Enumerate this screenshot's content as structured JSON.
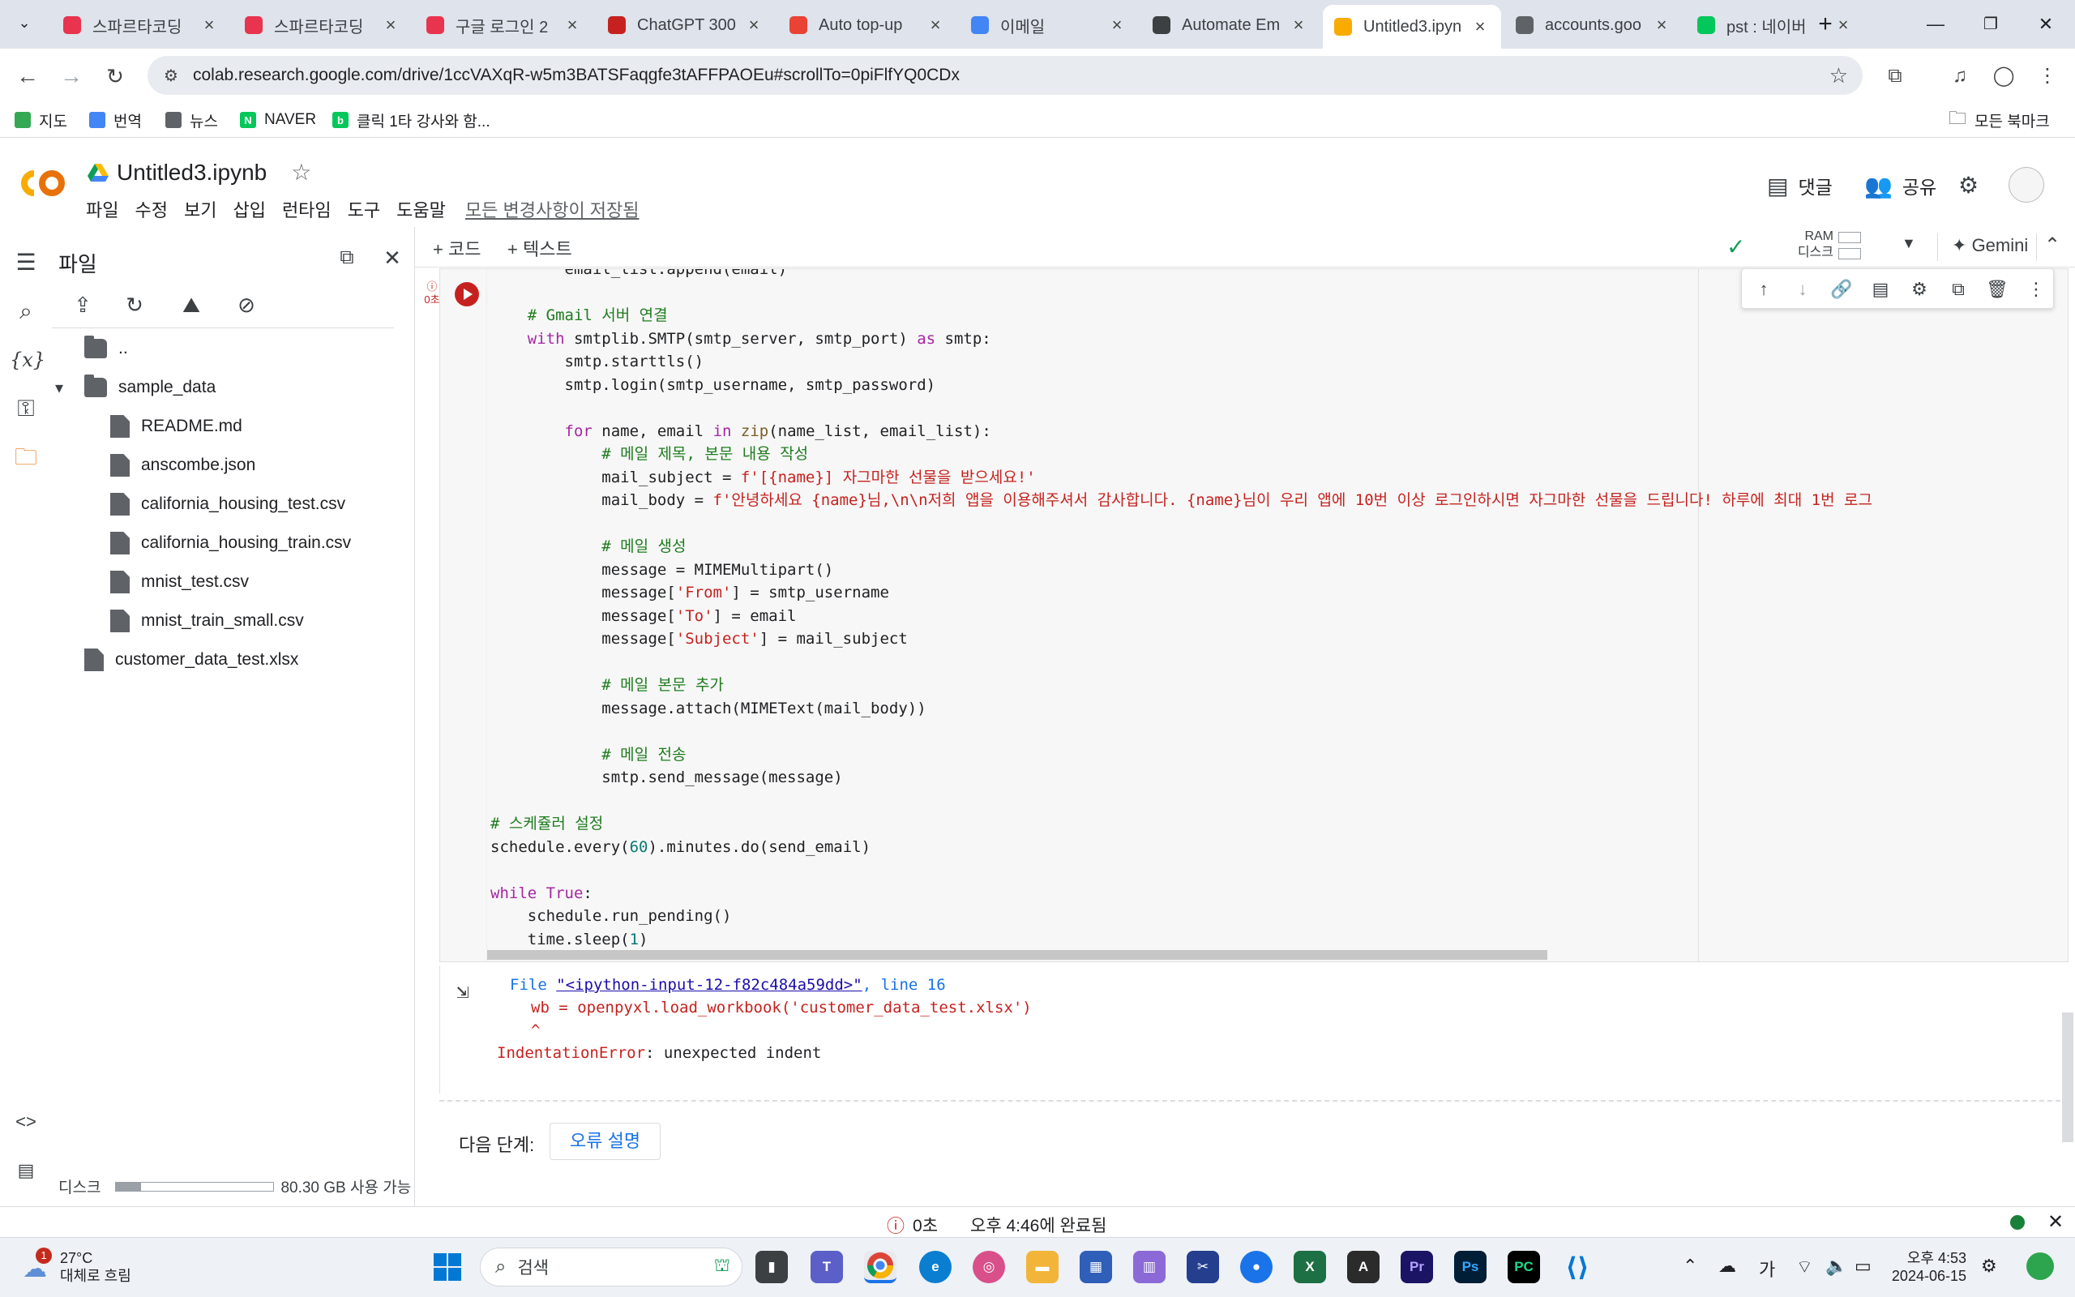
{
  "browser": {
    "tabs": [
      {
        "title": "스파르타코딩",
        "favicon_color": "#e8344e"
      },
      {
        "title": "스파르타코딩",
        "favicon_color": "#e8344e"
      },
      {
        "title": "구글 로그인 2",
        "favicon_color": "#e8344e"
      },
      {
        "title": "ChatGPT 300",
        "favicon_color": "#c5221f"
      },
      {
        "title": "Auto top-up",
        "favicon_color": "#ea4335"
      },
      {
        "title": "이메일",
        "favicon_color": "#4285f4"
      },
      {
        "title": "Automate Em",
        "favicon_color": "#3c4043"
      },
      {
        "title": "Untitled3.ipyn",
        "favicon_color": "#f9ab00"
      },
      {
        "title": "accounts.goo",
        "favicon_color": "#5f6368"
      },
      {
        "title": "pst : 네이버",
        "favicon_color": "#03c75a"
      }
    ],
    "active_tab_index": 7,
    "url": "colab.research.google.com/drive/1ccVAXqR-w5m3BATSFaqgfe3tAFFPAOEu#scrollTo=0piFlfYQ0CDx",
    "bookmarks": [
      {
        "label": "지도",
        "color": "#34a853"
      },
      {
        "label": "번역",
        "color": "#4285f4"
      },
      {
        "label": "뉴스",
        "color": "#5f6368"
      },
      {
        "label": "NAVER",
        "color": "#03c75a",
        "glyph": "N"
      },
      {
        "label": "클릭 1타 강사와 함...",
        "color": "#03c75a",
        "glyph": "b"
      }
    ],
    "all_bookmarks": "모든 북마크"
  },
  "colab": {
    "title": "Untitled3.ipynb",
    "menu": [
      "파일",
      "수정",
      "보기",
      "삽입",
      "런타임",
      "도구",
      "도움말"
    ],
    "saved_status": "모든 변경사항이 저장됨",
    "comment_label": "댓글",
    "share_label": "공유",
    "add_code": "+ 코드",
    "add_text": "+ 텍스트",
    "ram_label": "RAM",
    "disk_label": "디스크",
    "gemini_label": "Gemini"
  },
  "files_panel": {
    "title": "파일",
    "parent": "..",
    "items": [
      {
        "name": "sample_data",
        "type": "folder",
        "depth": 0,
        "expanded": true
      },
      {
        "name": "README.md",
        "type": "file",
        "depth": 1
      },
      {
        "name": "anscombe.json",
        "type": "file",
        "depth": 1
      },
      {
        "name": "california_housing_test.csv",
        "type": "file",
        "depth": 1
      },
      {
        "name": "california_housing_train.csv",
        "type": "file",
        "depth": 1
      },
      {
        "name": "mnist_test.csv",
        "type": "file",
        "depth": 1
      },
      {
        "name": "mnist_train_small.csv",
        "type": "file",
        "depth": 1
      },
      {
        "name": "customer_data_test.xlsx",
        "type": "file",
        "depth": 0
      }
    ],
    "disk_label": "디스크",
    "disk_available": "80.30 GB 사용 가능",
    "disk_used_fraction": 0.16
  },
  "cell": {
    "exec_time": "0초",
    "code_lines": [
      "        email_list.append(email)",
      "",
      "    # Gmail 서버 연결",
      "    with smtplib.SMTP(smtp_server, smtp_port) as smtp:",
      "        smtp.starttls()",
      "        smtp.login(smtp_username, smtp_password)",
      "",
      "        for name, email in zip(name_list, email_list):",
      "            # 메일 제목, 본문 내용 작성",
      "            mail_subject = f'[{name}] 자그마한 선물을 받으세요!'",
      "            mail_body = f'안녕하세요 {name}님,\\n\\n저희 앱을 이용해주셔서 감사합니다. {name}님이 우리 앱에 10번 이상 로그인하시면 자그마한 선물을 드립니다! 하루에 최대 1번 로그",
      "",
      "            # 메일 생성",
      "            message = MIMEMultipart()",
      "            message['From'] = smtp_username",
      "            message['To'] = email",
      "            message['Subject'] = mail_subject",
      "",
      "            # 메일 본문 추가",
      "            message.attach(MIMEText(mail_body))",
      "",
      "            # 메일 전송",
      "            smtp.send_message(message)",
      "",
      "# 스케쥴러 설정",
      "schedule.every(60).minutes.do(send_email)",
      "",
      "while True:",
      "    schedule.run_pending()",
      "    time.sleep(1)"
    ]
  },
  "output": {
    "file_prefix": "File ",
    "file_link": "\"<ipython-input-12-f82c484a59dd>\"",
    "line_text": ", line 16",
    "code_line": "wb = openpyxl.load_workbook('customer_data_test.xlsx')",
    "caret": "^",
    "error_type": "IndentationError",
    "error_msg": ": unexpected indent",
    "next_step_label": "다음 단계:",
    "explain_button": "오류 설명"
  },
  "statusbar": {
    "time": "0초",
    "completed": "오후 4:46에 완료됨"
  },
  "taskbar": {
    "weather_temp": "27°C",
    "weather_desc": "대체로 흐림",
    "weather_badge": "1",
    "search_placeholder": "검색",
    "time": "오후 4:53",
    "date": "2024-06-15",
    "ime": "가"
  }
}
